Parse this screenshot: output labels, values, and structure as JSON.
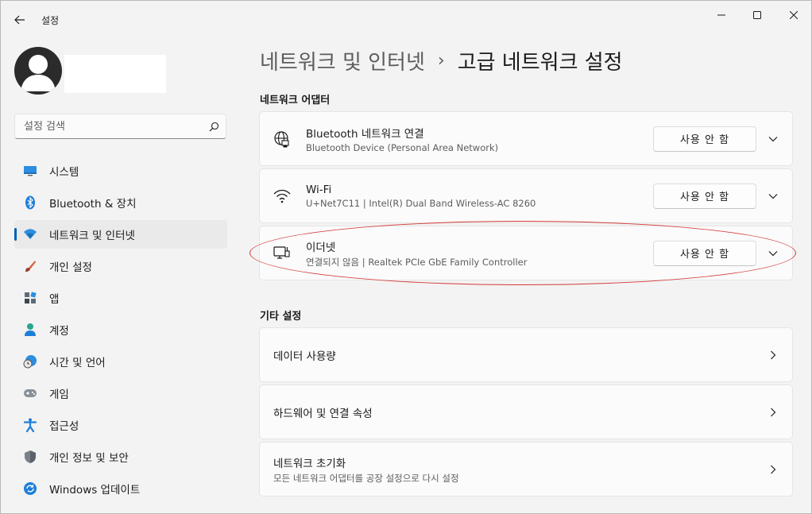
{
  "window": {
    "app_title": "설정",
    "back_icon": "back-arrow-icon",
    "controls": [
      "minimize-icon",
      "maximize-icon",
      "close-icon"
    ]
  },
  "sidebar": {
    "search": {
      "placeholder": "설정 검색",
      "value": ""
    },
    "items": [
      {
        "label": "시스템",
        "icon": "system-icon",
        "active": false
      },
      {
        "label": "Bluetooth & 장치",
        "icon": "bluetooth-icon",
        "active": false
      },
      {
        "label": "네트워크 및 인터넷",
        "icon": "network-icon",
        "active": true
      },
      {
        "label": "개인 설정",
        "icon": "brush-icon",
        "active": false
      },
      {
        "label": "앱",
        "icon": "apps-icon",
        "active": false
      },
      {
        "label": "계정",
        "icon": "account-icon",
        "active": false
      },
      {
        "label": "시간 및 언어",
        "icon": "time-language-icon",
        "active": false
      },
      {
        "label": "게임",
        "icon": "gaming-icon",
        "active": false
      },
      {
        "label": "접근성",
        "icon": "accessibility-icon",
        "active": false
      },
      {
        "label": "개인 정보 및 보안",
        "icon": "shield-icon",
        "active": false
      },
      {
        "label": "Windows 업데이트",
        "icon": "update-icon",
        "active": false
      }
    ]
  },
  "main": {
    "breadcrumb": {
      "parent": "네트워크 및 인터넷",
      "separator": "›",
      "current": "고급 네트워크 설정"
    },
    "adapters_section": {
      "title": "네트워크 어댑터",
      "items": [
        {
          "title": "Bluetooth 네트워크 연결",
          "subtitle": "Bluetooth Device (Personal Area Network)",
          "button": "사용 안 함",
          "icon": "globe-network-icon"
        },
        {
          "title": "Wi-Fi",
          "subtitle": "U+Net7C11 | Intel(R) Dual Band Wireless-AC 8260",
          "button": "사용 안 함",
          "icon": "wifi-icon"
        },
        {
          "title": "이더넷",
          "subtitle": "연결되지 않음 | Realtek PCIe GbE Family Controller",
          "button": "사용 안 함",
          "icon": "ethernet-icon"
        }
      ]
    },
    "other_section": {
      "title": "기타 설정",
      "items": [
        {
          "title": "데이터 사용량",
          "subtitle": ""
        },
        {
          "title": "하드웨어 및 연결 속성",
          "subtitle": ""
        },
        {
          "title": "네트워크 초기화",
          "subtitle": "모든 네트워크 어댑터를 공장 설정으로 다시 설정"
        }
      ]
    },
    "annotation_color": "#d43a3a",
    "accent_color": "#005fb8"
  }
}
